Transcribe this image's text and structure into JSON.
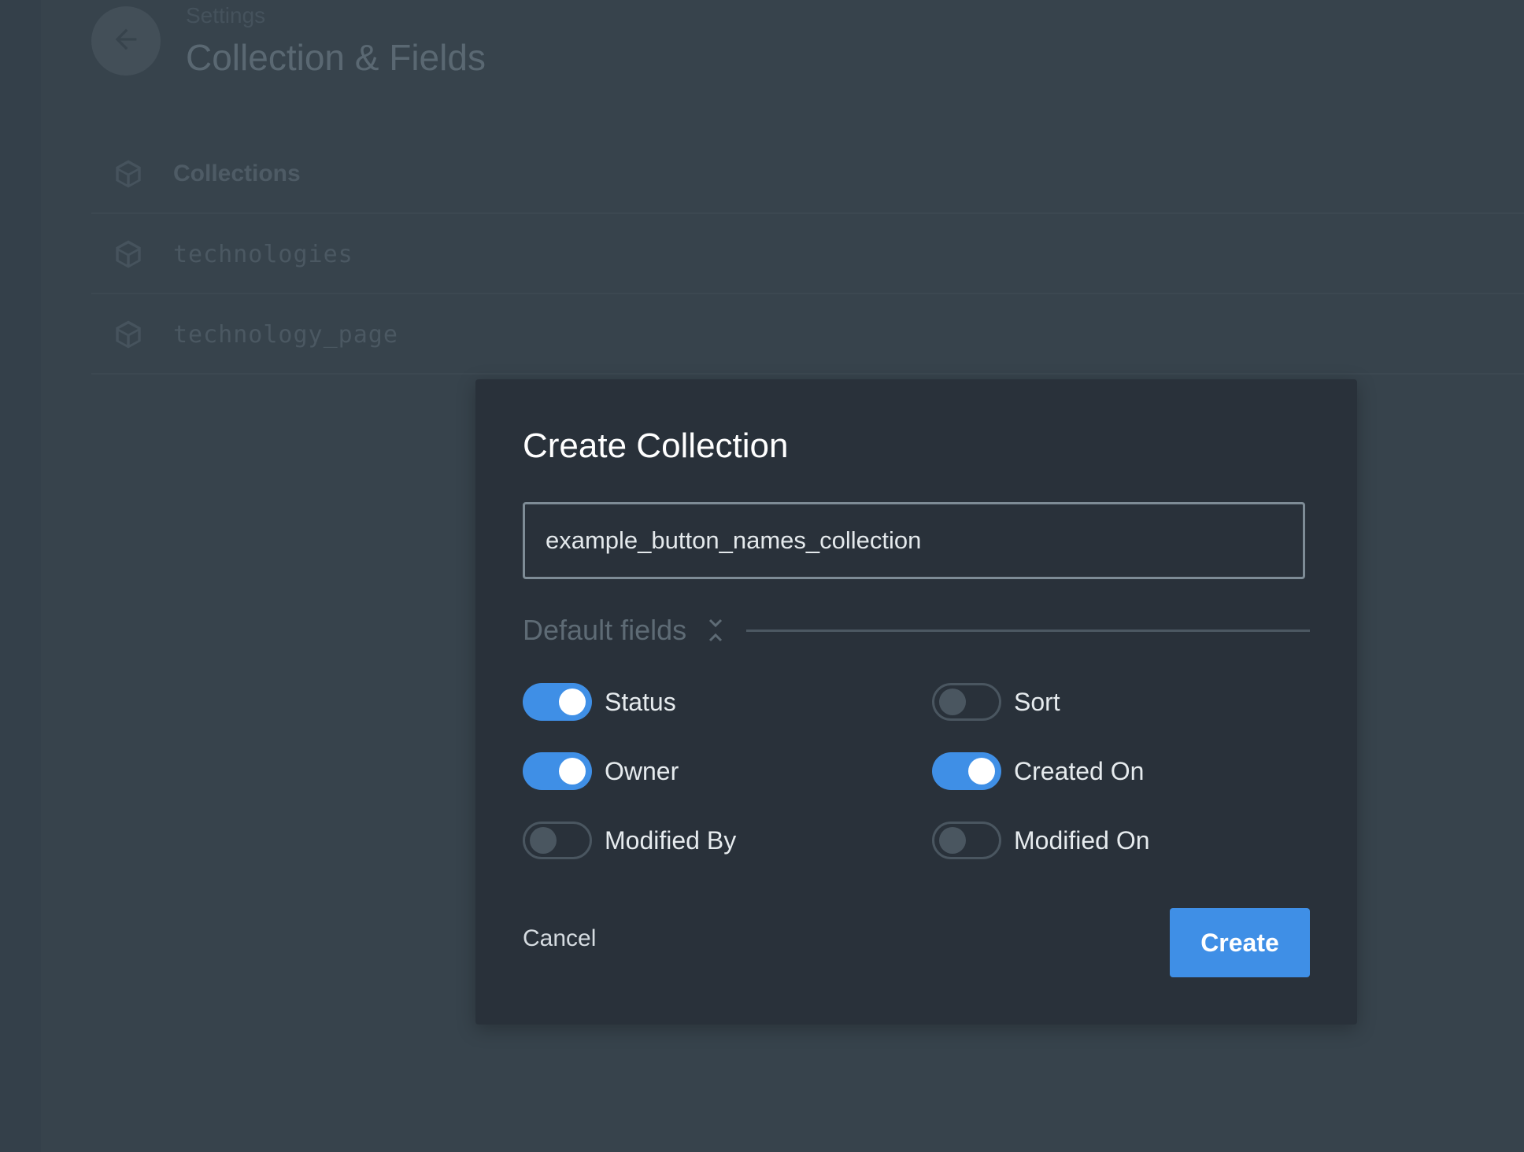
{
  "background": {
    "breadcrumb": "Settings",
    "page_title": "Collection & Fields",
    "collections_header": "Collections",
    "collections": [
      "technologies",
      "technology_page"
    ]
  },
  "modal": {
    "title": "Create Collection",
    "name_input_value": "example_button_names_collection",
    "default_fields_label": "Default fields",
    "toggles": [
      {
        "label": "Status",
        "on": true
      },
      {
        "label": "Sort",
        "on": false
      },
      {
        "label": "Owner",
        "on": true
      },
      {
        "label": "Created On",
        "on": true
      },
      {
        "label": "Modified By",
        "on": false
      },
      {
        "label": "Modified On",
        "on": false
      }
    ],
    "cancel_label": "Cancel",
    "create_label": "Create"
  },
  "colors": {
    "accent": "#3f8fe6",
    "modal_bg": "#29313a",
    "page_bg": "#37434c"
  },
  "icons": {
    "back": "arrow-left-icon",
    "collection": "box-icon",
    "expand": "chevron-collapse-icon"
  }
}
